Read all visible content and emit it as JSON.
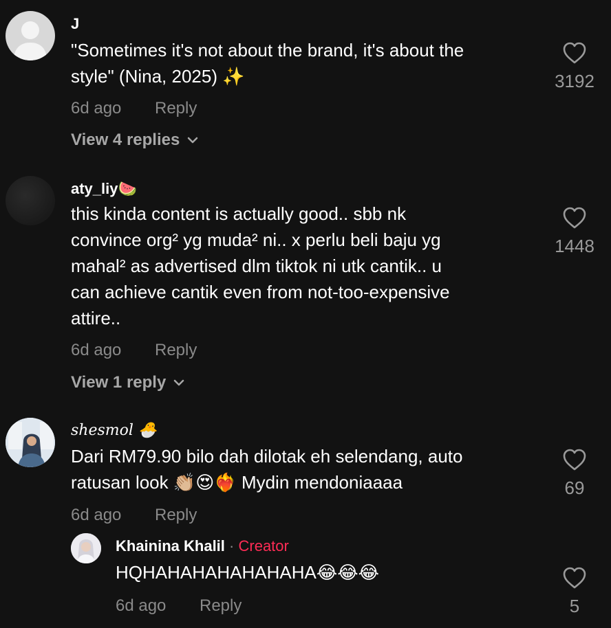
{
  "comments": [
    {
      "username": "J",
      "text": "\"Sometimes it's not about the brand, it's about the style\" (Nina, 2025)",
      "text_line1": "\"Sometimes it's not about the brand, it's about the",
      "text_line2": "style\" (Nina, 2025) ✨",
      "time": "6d ago",
      "reply_label": "Reply",
      "likes": "3192",
      "view_replies": "View 4 replies"
    },
    {
      "username": "aty_liy🍉",
      "text_lines": [
        "this kinda content is actually good.. sbb nk",
        "convince org² yg muda² ni.. x perlu beli baju yg",
        "mahal² as advertised dlm tiktok ni utk cantik.. u",
        "can achieve cantik even from not-too-expensive",
        "attire.."
      ],
      "time": "6d ago",
      "reply_label": "Reply",
      "likes": "1448",
      "view_replies": "View 1 reply"
    },
    {
      "username": "shesmol 🐣",
      "text_line1": "Dari RM79.90 bilo dah dilotak eh selendang, auto",
      "text_line2": "ratusan look 👏🏼😍❤️‍🔥 Mydin mendoniaaaa",
      "time": "6d ago",
      "reply_label": "Reply",
      "likes": "69"
    }
  ],
  "reply": {
    "username": "Khainina Khalil",
    "separator": "·",
    "badge": "Creator",
    "text": "HQHAHAHAHAHAHAHA😂😂😂",
    "time": "6d ago",
    "reply_label": "Reply",
    "likes": "5"
  },
  "icons": {
    "like": "heart-outline-icon",
    "expand": "chevron-down-icon"
  },
  "colors": {
    "background": "#121212",
    "text": "#ffffff",
    "muted": "#8a8a8a",
    "creator": "#fe2c55"
  }
}
